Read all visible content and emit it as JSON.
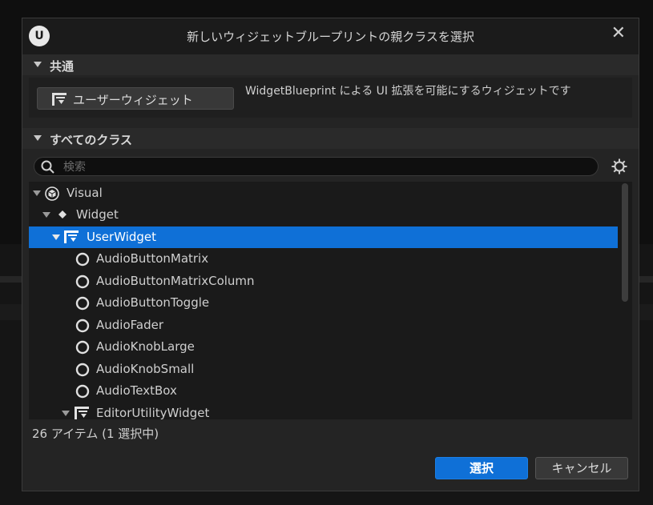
{
  "dialog": {
    "title": "新しいウィジェットブループリントの親クラスを選択",
    "logo": "U",
    "close_label": "✕"
  },
  "common": {
    "header": "共通",
    "button_label": "ユーザーウィジェット",
    "description": "WidgetBlueprint による UI 拡張を可能にするウィジェットです"
  },
  "all_classes": {
    "header": "すべてのクラス",
    "search_placeholder": "検索",
    "search_value": ""
  },
  "tree": [
    {
      "label": "Visual",
      "icon": "visual-cube-icon",
      "expanded": true
    },
    {
      "label": "Widget",
      "icon": "diamond-icon",
      "expanded": true
    },
    {
      "label": "UserWidget",
      "icon": "user-widget-icon",
      "expanded": true,
      "selected": true
    },
    {
      "label": "AudioButtonMatrix",
      "icon": "circle-icon"
    },
    {
      "label": "AudioButtonMatrixColumn",
      "icon": "circle-icon"
    },
    {
      "label": "AudioButtonToggle",
      "icon": "circle-icon"
    },
    {
      "label": "AudioFader",
      "icon": "circle-icon"
    },
    {
      "label": "AudioKnobLarge",
      "icon": "circle-icon"
    },
    {
      "label": "AudioKnobSmall",
      "icon": "circle-icon"
    },
    {
      "label": "AudioTextBox",
      "icon": "circle-icon"
    },
    {
      "label": "EditorUtilityWidget",
      "icon": "user-widget-icon",
      "expanded": true
    }
  ],
  "status": "26 アイテム (1 選択中)",
  "buttons": {
    "select": "選択",
    "cancel": "キャンセル"
  },
  "colors": {
    "accent": "#0f70d7",
    "dialog_bg": "#242424",
    "titlebar_bg": "#1b1b1b"
  }
}
